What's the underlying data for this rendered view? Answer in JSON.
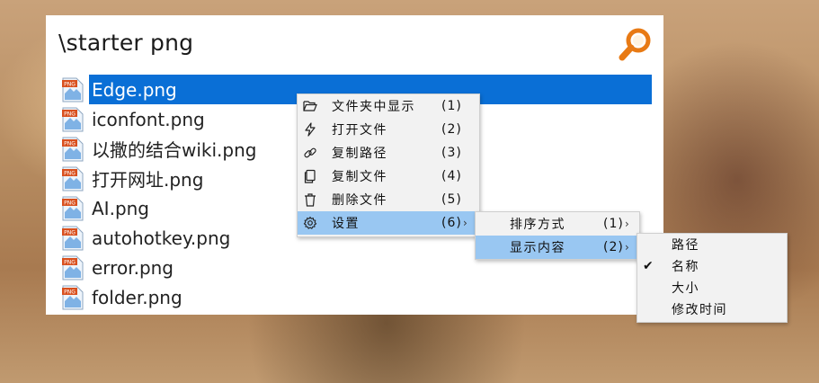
{
  "search": {
    "query": "\\starter png"
  },
  "results": [
    {
      "name": "Edge.png",
      "selected": true
    },
    {
      "name": "iconfont.png"
    },
    {
      "name": "以撒的结合wiki.png"
    },
    {
      "name": "打开网址.png"
    },
    {
      "name": "AI.png"
    },
    {
      "name": "autohotkey.png"
    },
    {
      "name": "error.png"
    },
    {
      "name": "folder.png"
    }
  ],
  "file_icon_text": "PNG",
  "context_menu": [
    {
      "label": "文件夹中显示",
      "key": "(1)",
      "icon": "folder-open-icon"
    },
    {
      "label": "打开文件",
      "key": "(2)",
      "icon": "lightning-icon"
    },
    {
      "label": "复制路径",
      "key": "(3)",
      "icon": "link-icon"
    },
    {
      "label": "复制文件",
      "key": "(4)",
      "icon": "copy-icon"
    },
    {
      "label": "删除文件",
      "key": "(5)",
      "icon": "trash-icon"
    },
    {
      "label": "设置",
      "key": "(6)",
      "icon": "gear-icon",
      "submenu": true,
      "highlight": true
    }
  ],
  "settings_menu": [
    {
      "label": "排序方式",
      "key": "(1)",
      "submenu": true
    },
    {
      "label": "显示内容",
      "key": "(2)",
      "submenu": true,
      "highlight": true
    }
  ],
  "display_menu": [
    {
      "label": "路径",
      "checked": false
    },
    {
      "label": "名称",
      "checked": true
    },
    {
      "label": "大小",
      "checked": false
    },
    {
      "label": "修改时间",
      "checked": false
    }
  ],
  "colors": {
    "selection": "#0a6fd6",
    "menu_highlight": "#99c7f2",
    "search_icon": "#e87a14"
  }
}
